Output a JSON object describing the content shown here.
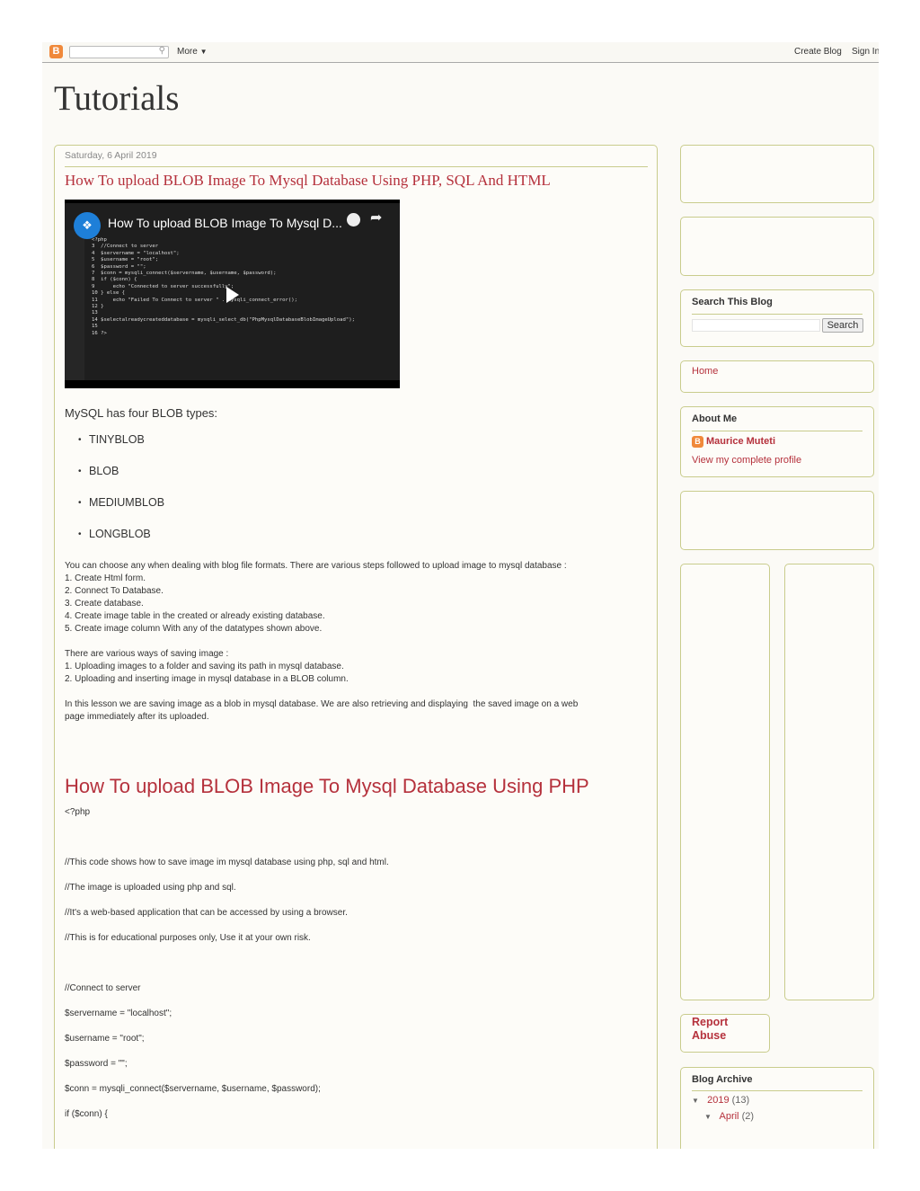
{
  "navbar": {
    "more": "More",
    "create_blog": "Create Blog",
    "sign_in": "Sign In",
    "search_value": ""
  },
  "blog": {
    "title": "Tutorials"
  },
  "post": {
    "date": "Saturday, 6 April 2019",
    "title": "How To upload BLOB Image To Mysql Database Using PHP, SQL And HTML",
    "video": {
      "title": "How To upload BLOB Image To Mysql D...",
      "code": [
        "<?php",
        "",
        "3  //Connect to server",
        "4  $servername = \"localhost\";",
        "5  $username = \"root\";",
        "6  $password = \"\";",
        "7  $conn = mysqli_connect($servername, $username, $password);",
        "8  if ($conn) {",
        "9      echo \"Connected to server successfully\";",
        "10 } else {",
        "11     echo \"Failed To Connect to server \" . mysqli_connect_error();",
        "12 }",
        "13",
        "14 $selectalreadycreateddatabase = mysqli_select_db(\"PhpMysqlDatabaseBlobImageUpload\");",
        "15",
        "16 ?>"
      ]
    },
    "intro": "MySQL has four BLOB types:",
    "blob_types": [
      "TINYBLOB",
      "BLOB",
      "MEDIUMBLOB",
      "LONGBLOB"
    ],
    "para1": [
      "You can choose any when dealing with blog file formats. There are various steps followed to upload image to mysql database :",
      "1. Create Html form.",
      "2. Connect To Database.",
      "3. Create database.",
      "4. Create image table in the created or already existing database.",
      "5. Create image column With any of the datatypes shown above."
    ],
    "para2": [
      "There are various ways of saving image :",
      "1. Uploading images to a folder and saving its path in mysql database.",
      "2. Uploading and inserting image in mysql database in a BLOB column."
    ],
    "para3": [
      "In this lesson we are saving image as a blob in mysql database. We are also retrieving and displaying  the saved image on a web",
      "page immediately after its uploaded."
    ],
    "heading": "How To upload BLOB Image To Mysql Database Using PHP",
    "code": [
      "<?php",
      "//This code shows how to save image im mysql database using php, sql and html.",
      "//The image is uploaded using php and sql.",
      "//It's a web-based application that can be accessed by using a browser.",
      "//This is for educational purposes only, Use it at your own risk.",
      "//Connect to server",
      "$servername = \"localhost\";",
      "$username = \"root\";",
      "$password = \"\";",
      "$conn = mysqli_connect($servername, $username, $password);",
      "if ($conn) {"
    ]
  },
  "sidebar": {
    "search": {
      "title": "Search This Blog",
      "button": "Search",
      "value": ""
    },
    "pages": {
      "home": "Home"
    },
    "about": {
      "title": "About Me",
      "name": "Maurice Muteti",
      "profile_link": "View my complete profile"
    },
    "report_abuse": "Report Abuse",
    "archive": {
      "title": "Blog Archive",
      "year": "2019",
      "year_count": "(13)",
      "month": "April",
      "month_count": "(2)"
    }
  },
  "colors": {
    "accent": "#b5313c",
    "border": "#c9cc8d",
    "background": "#fbfaf6"
  }
}
